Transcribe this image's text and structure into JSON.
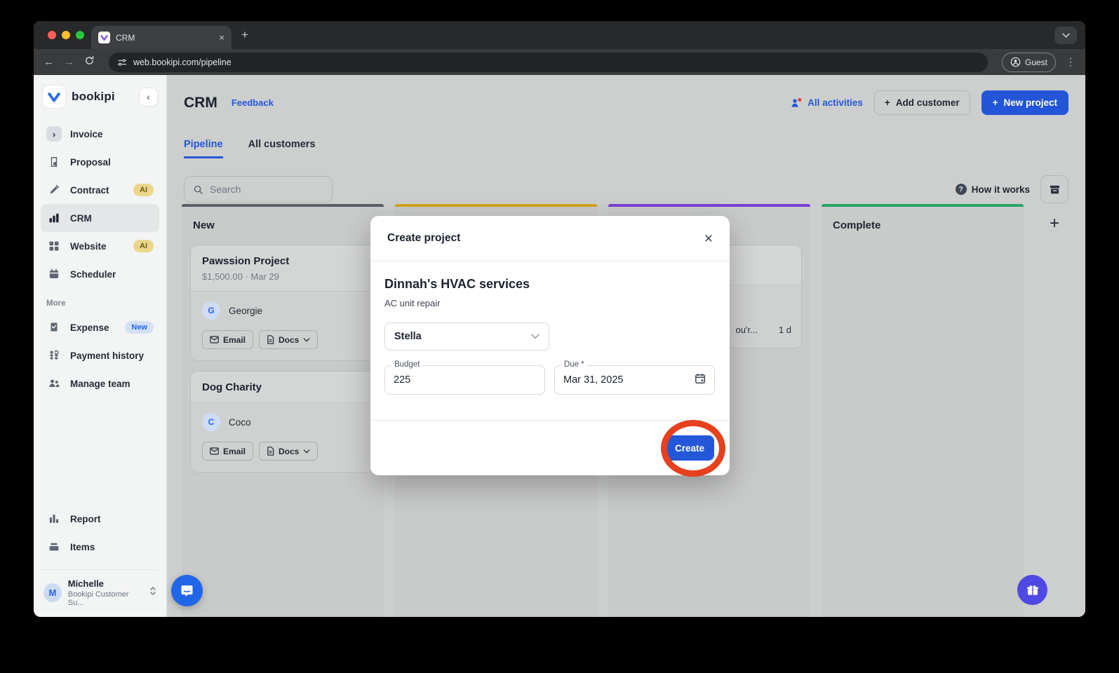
{
  "browser": {
    "tab_title": "CRM",
    "url": "web.bookipi.com/pipeline",
    "guest_label": "Guest"
  },
  "icons": {
    "plus": "+",
    "close": "×",
    "back": "←",
    "forward": "→",
    "chevron_left": "‹",
    "chevron_right": "›",
    "dots_vertical": "⋮",
    "question": "?"
  },
  "sidebar": {
    "brand": "bookipi",
    "items": [
      {
        "label": "Invoice"
      },
      {
        "label": "Proposal"
      },
      {
        "label": "Contract",
        "badge": "AI"
      },
      {
        "label": "CRM"
      },
      {
        "label": "Website",
        "badge": "AI"
      },
      {
        "label": "Scheduler"
      }
    ],
    "more_label": "More",
    "more_items": [
      {
        "label": "Expense",
        "badge": "New"
      },
      {
        "label": "Payment history"
      },
      {
        "label": "Manage team"
      }
    ],
    "bottom_items": [
      {
        "label": "Report"
      },
      {
        "label": "Items"
      }
    ],
    "profile": {
      "initial": "M",
      "name": "Michelle",
      "subtitle": "Bookipi Customer Su..."
    }
  },
  "header": {
    "title": "CRM",
    "feedback": "Feedback",
    "all_activities": "All activities",
    "add_customer": "Add customer",
    "new_project": "New project"
  },
  "tabs": {
    "pipeline": "Pipeline",
    "all_customers": "All customers"
  },
  "controls": {
    "search_placeholder": "Search",
    "how_it_works": "How it works"
  },
  "board": {
    "columns": [
      {
        "name": "New",
        "color": "#575f6b"
      },
      {
        "name": "",
        "color": "#d1a517"
      },
      {
        "name": "",
        "color": "#7e3ed6"
      },
      {
        "name": "Complete",
        "color": "#28a569"
      }
    ],
    "cards": [
      {
        "title": "Pawssion Project",
        "meta": "$1,500.00 · Mar 29",
        "contact_initial": "G",
        "contact_name": "Georgie",
        "email_label": "Email",
        "docs_label": "Docs"
      },
      {
        "title": "Dog Charity",
        "contact_initial": "C",
        "contact_name": "Coco",
        "email_label": "Email",
        "docs_label": "Docs"
      }
    ],
    "peek_card": {
      "snippet": "ou'r...",
      "time": "1 d"
    }
  },
  "modal": {
    "title": "Create project",
    "project_name": "Dinnah's HVAC services",
    "description": "AC unit repair",
    "assignee": "Stella",
    "budget_label": "Budget",
    "budget_value": "225",
    "due_label": "Due *",
    "due_value": "Mar 31, 2025",
    "create_label": "Create"
  },
  "colors": {
    "accent_blue": "#2457d8",
    "annotation_red": "#e6401d",
    "badge_ai_bg": "#ecd88c",
    "badge_new_bg": "#d3e1f8",
    "column_new": "#575f6b",
    "column_second": "#d1a517",
    "column_third": "#7e3ed6",
    "column_complete": "#28a569"
  }
}
